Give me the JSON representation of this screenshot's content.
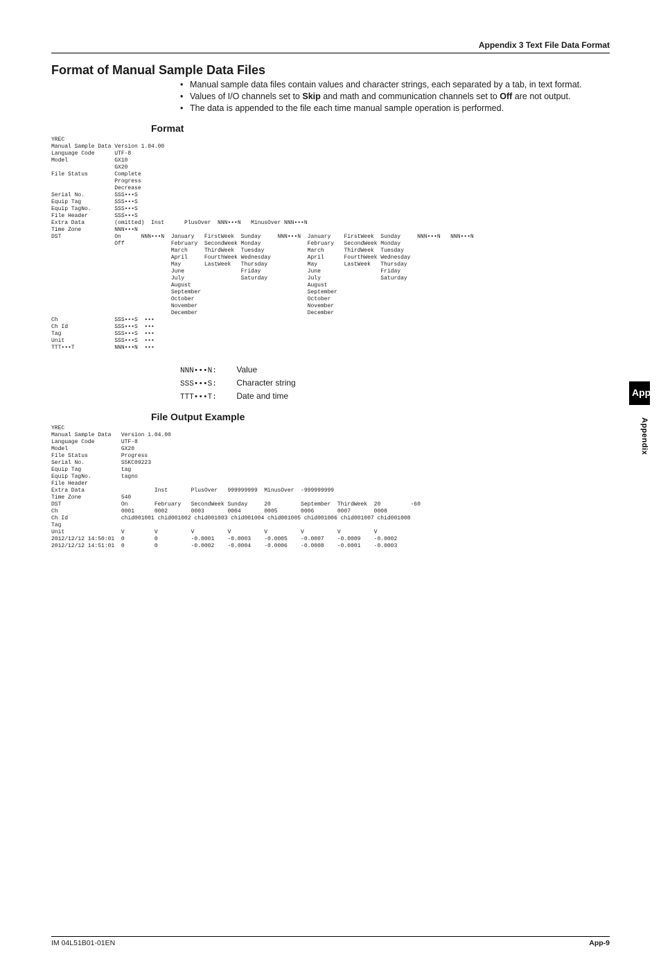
{
  "header": {
    "appendix_title": "Appendix 3 Text File Data Format"
  },
  "title": "Format of Manual Sample Data Files",
  "bullets": [
    "Manual sample data files contain values and character strings, each separated by a tab, in text format.",
    "Values of I/O channels set to Skip and math and communication channels set to Off are not output.",
    "The data is appended to the file each time manual sample operation is performed."
  ],
  "sections": {
    "format_heading": "Format",
    "example_heading": "File Output Example"
  },
  "format_block": "YREC\nManual Sample Data Version 1.04.00\nLanguage Code      UTF-8\nModel              GX10\n                   GX20\nFile Status        Complete\n                   Progress\n                   Decrease\nSerial No.         SSS•••S\nEquip Tag          SSS•••S\nEquip TagNo.       SSS•••S\nFile Header        SSS•••S\nExtra Data         (omitted)  Inst      PlusOver  NNN•••N   MinusOver NNN•••N\nTime Zone          NNN•••N\nDST                On      NNN•••N  January   FirstWeek  Sunday     NNN•••N  January    FirstWeek  Sunday     NNN•••N   NNN•••N\n                   Off              February  SecondWeek Monday              February   SecondWeek Monday\n                                    March     ThirdWeek  Tuesday             March      ThirdWeek  Tuesday\n                                    April     FourthWeek Wednesday           April      FourthWeek Wednesday\n                                    May       LastWeek   Thursday            May        LastWeek   Thursday\n                                    June                 Friday              June                  Friday\n                                    July                 Saturday            July                  Saturday\n                                    August                                   August\n                                    September                                September\n                                    October                                  October\n                                    November                                 November\n                                    December                                 December\nCh                 SSS•••S  •••\nCh Id              SSS•••S  •••\nTag                SSS•••S  •••\nUnit               SSS•••S  •••\nTTT•••T            NNN•••N  •••",
  "legend": {
    "nnn": {
      "key": "NNN•••N:",
      "val": "Value"
    },
    "sss": {
      "key": "SSS•••S:",
      "val": "Character string"
    },
    "ttt": {
      "key": "TTT•••T:",
      "val": "Date and time"
    }
  },
  "example_block": "YREC\nManual Sample Data   Version 1.04.00\nLanguage Code        UTF-8\nModel                GX20\nFile Status          Progress\nSerial No.           S5KC09223\nEquip Tag            tag\nEquip TagNo.         tagno\nFile Header\nExtra Data                     Inst       PlusOver   999999999  MinusOver  -999999999\nTime Zone            540\nDST                  On        February   SecondWeek Sunday     20         September  ThirdWeek  20         -60\nCh                   0001      0002       0003       0004       0005       0006       0007       0008\nCh Id                chid001001 chid001002 chid001003 chid001004 chid001005 chid001006 chid001007 chid001008\nTag\nUnit                 V         V          V          V          V          V          V          V\n2012/12/12 14:50:01  0         0          -0.0001    -0.0003    -0.0005    -0.0007    -0.0009    -0.0002\n2012/12/12 14:51:01  0         0          -0.0002    -0.0004    -0.0006    -0.0008    -0.0001    -0.0003",
  "side": {
    "tab": "App",
    "label": "Appendix"
  },
  "footer": {
    "left": "IM 04L51B01-01EN",
    "right": "App-9"
  }
}
